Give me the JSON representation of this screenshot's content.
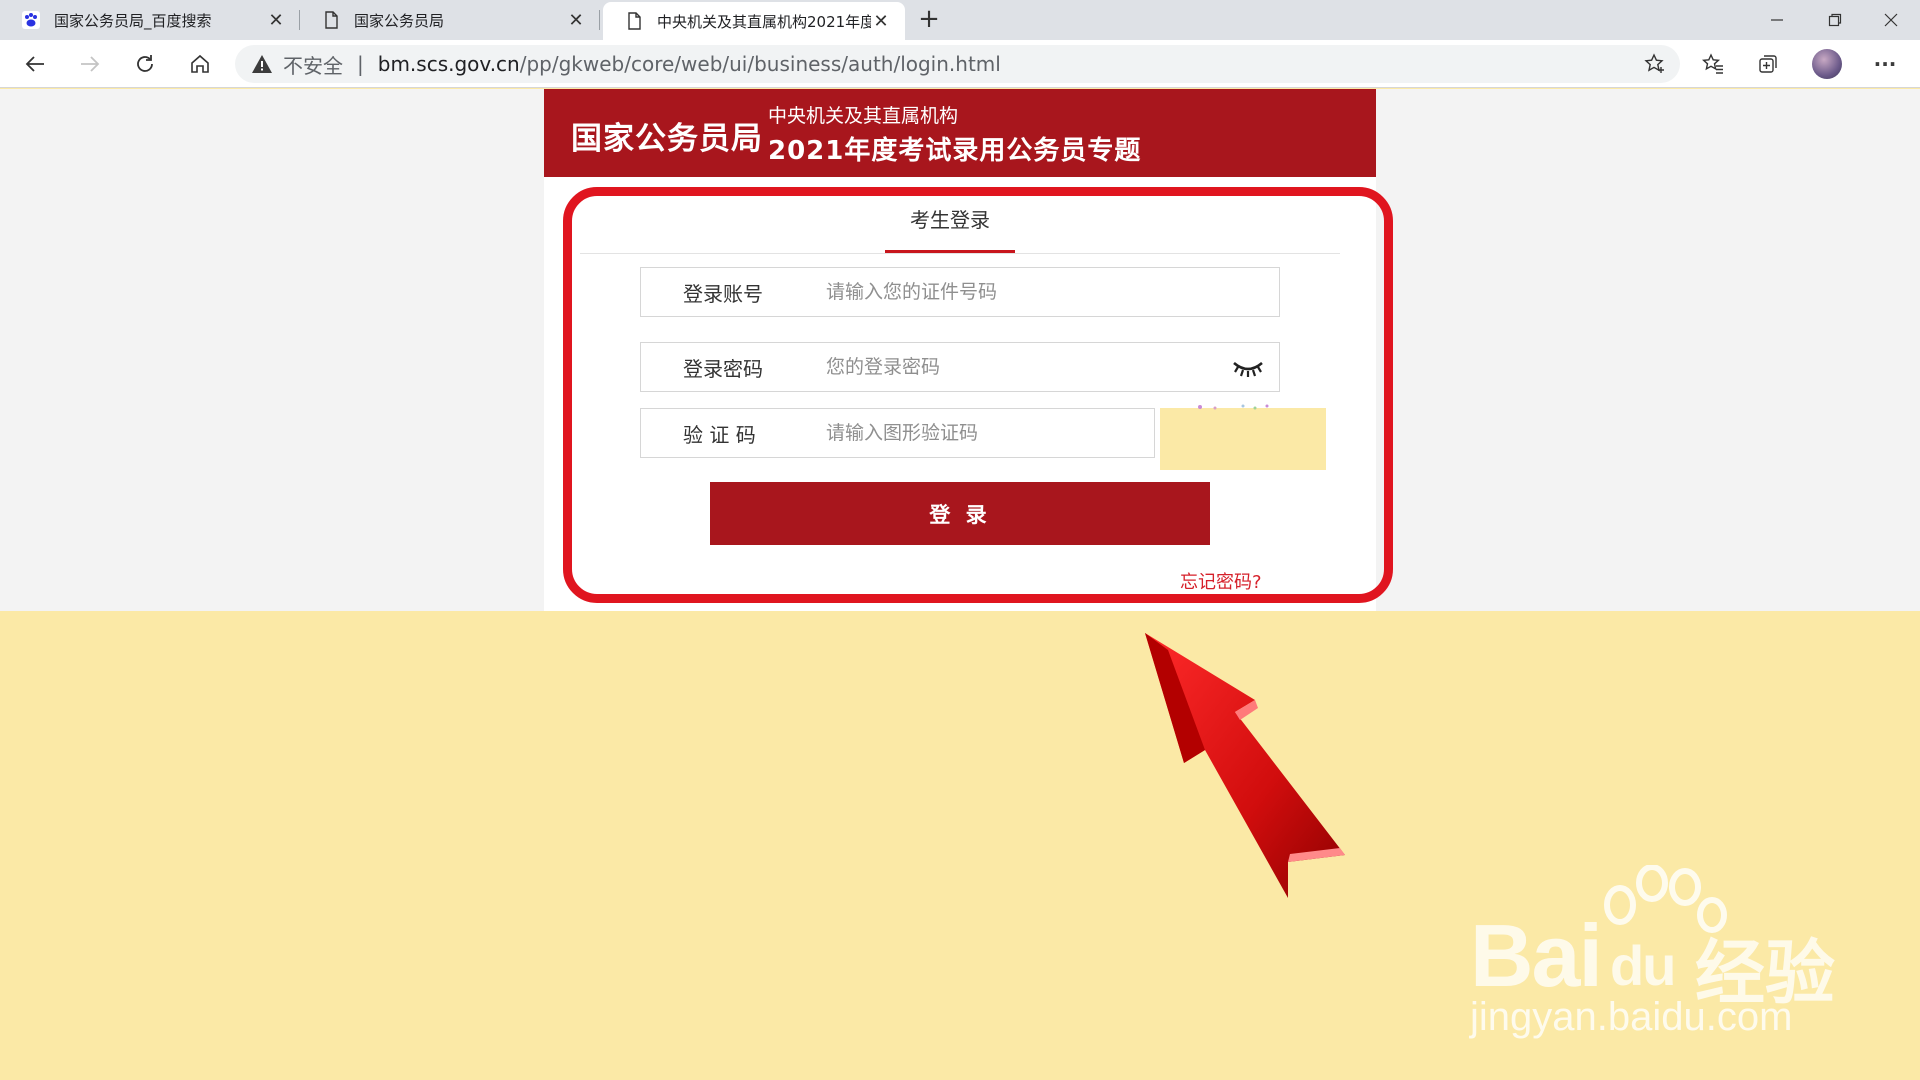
{
  "browser": {
    "tabs": [
      {
        "title": "国家公务员局_百度搜索",
        "favicon": "baidu-paw-icon",
        "active": false
      },
      {
        "title": "国家公务员局",
        "favicon": "page-icon",
        "active": false
      },
      {
        "title": "中央机关及其直属机构2021年度",
        "favicon": "page-icon",
        "active": true
      }
    ],
    "close_glyph": "✕",
    "new_tab_glyph": "+",
    "security_label": "不安全",
    "url_host": "bm.scs.gov.cn",
    "url_path": "/pp/gkweb/core/web/ui/business/auth/login.html",
    "more_glyph": "···"
  },
  "header": {
    "brand": "国家公务员局",
    "subtitle_line1": "中央机关及其直属机构",
    "subtitle_line2": "2021年度考试录用公务员专题",
    "bg_color": "#a8161d"
  },
  "login": {
    "tab_label": "考生登录",
    "account_label": "登录账号",
    "account_placeholder": "请输入您的证件号码",
    "password_label": "登录密码",
    "password_placeholder": "您的登录密码",
    "captcha_label": "验 证 码",
    "captcha_placeholder": "请输入图形验证码",
    "submit_label": "登 录",
    "forgot_label": "忘记密码?"
  },
  "annotation": {
    "highlight_color": "#e0151f",
    "arrow_color": "#e0151f"
  },
  "watermark": {
    "logo_text": "Bai",
    "logo_du": "du",
    "logo_cn": "经验",
    "url": "jingyan.baidu.com"
  }
}
